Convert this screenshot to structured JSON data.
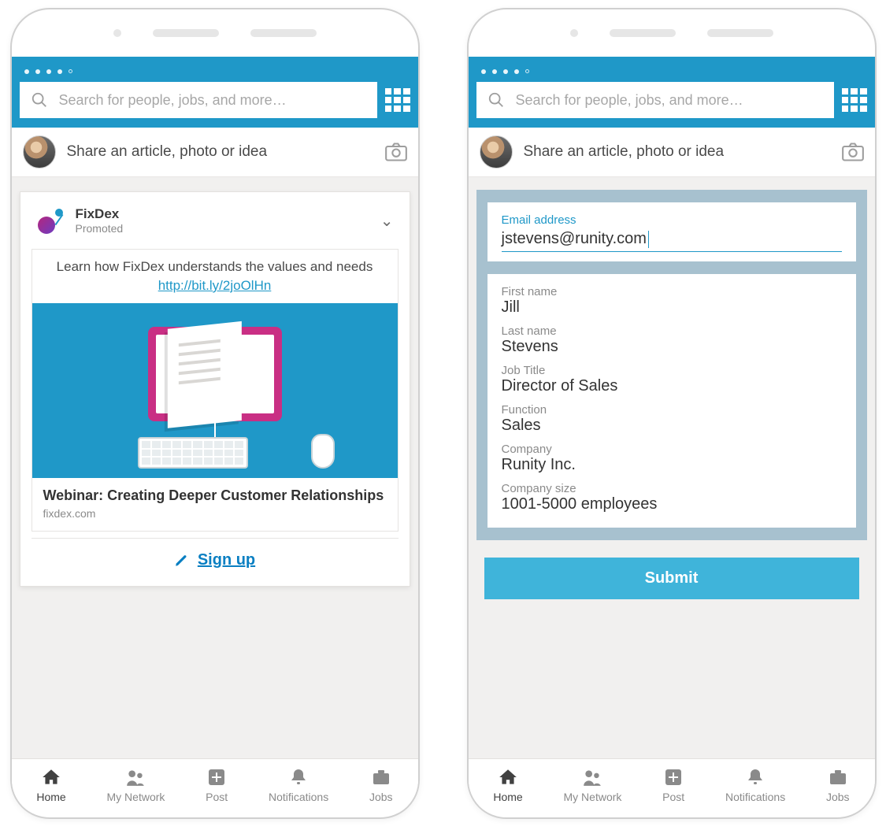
{
  "header": {
    "search_placeholder": "Search for people, jobs, and more…"
  },
  "share": {
    "prompt": "Share an article, photo or idea"
  },
  "card": {
    "company": "FixDex",
    "subtitle": "Promoted",
    "teaser": "Learn how FixDex understands the values and needs",
    "link": "http://bit.ly/2joOlHn",
    "title": "Webinar: Creating Deeper Customer Relationships",
    "domain": "fixdex.com",
    "cta": "Sign up"
  },
  "form": {
    "email_label": "Email address",
    "email_value": "jstevens@runity.com",
    "fields": [
      {
        "label": "First name",
        "value": "Jill"
      },
      {
        "label": "Last name",
        "value": "Stevens"
      },
      {
        "label": "Job Title",
        "value": "Director of Sales"
      },
      {
        "label": "Function",
        "value": "Sales"
      },
      {
        "label": "Company",
        "value": "Runity Inc."
      },
      {
        "label": "Company size",
        "value": "1001-5000 employees"
      }
    ],
    "submit_label": "Submit"
  },
  "nav": {
    "items": [
      {
        "label": "Home"
      },
      {
        "label": "My Network"
      },
      {
        "label": "Post"
      },
      {
        "label": "Notifications"
      },
      {
        "label": "Jobs"
      }
    ]
  }
}
